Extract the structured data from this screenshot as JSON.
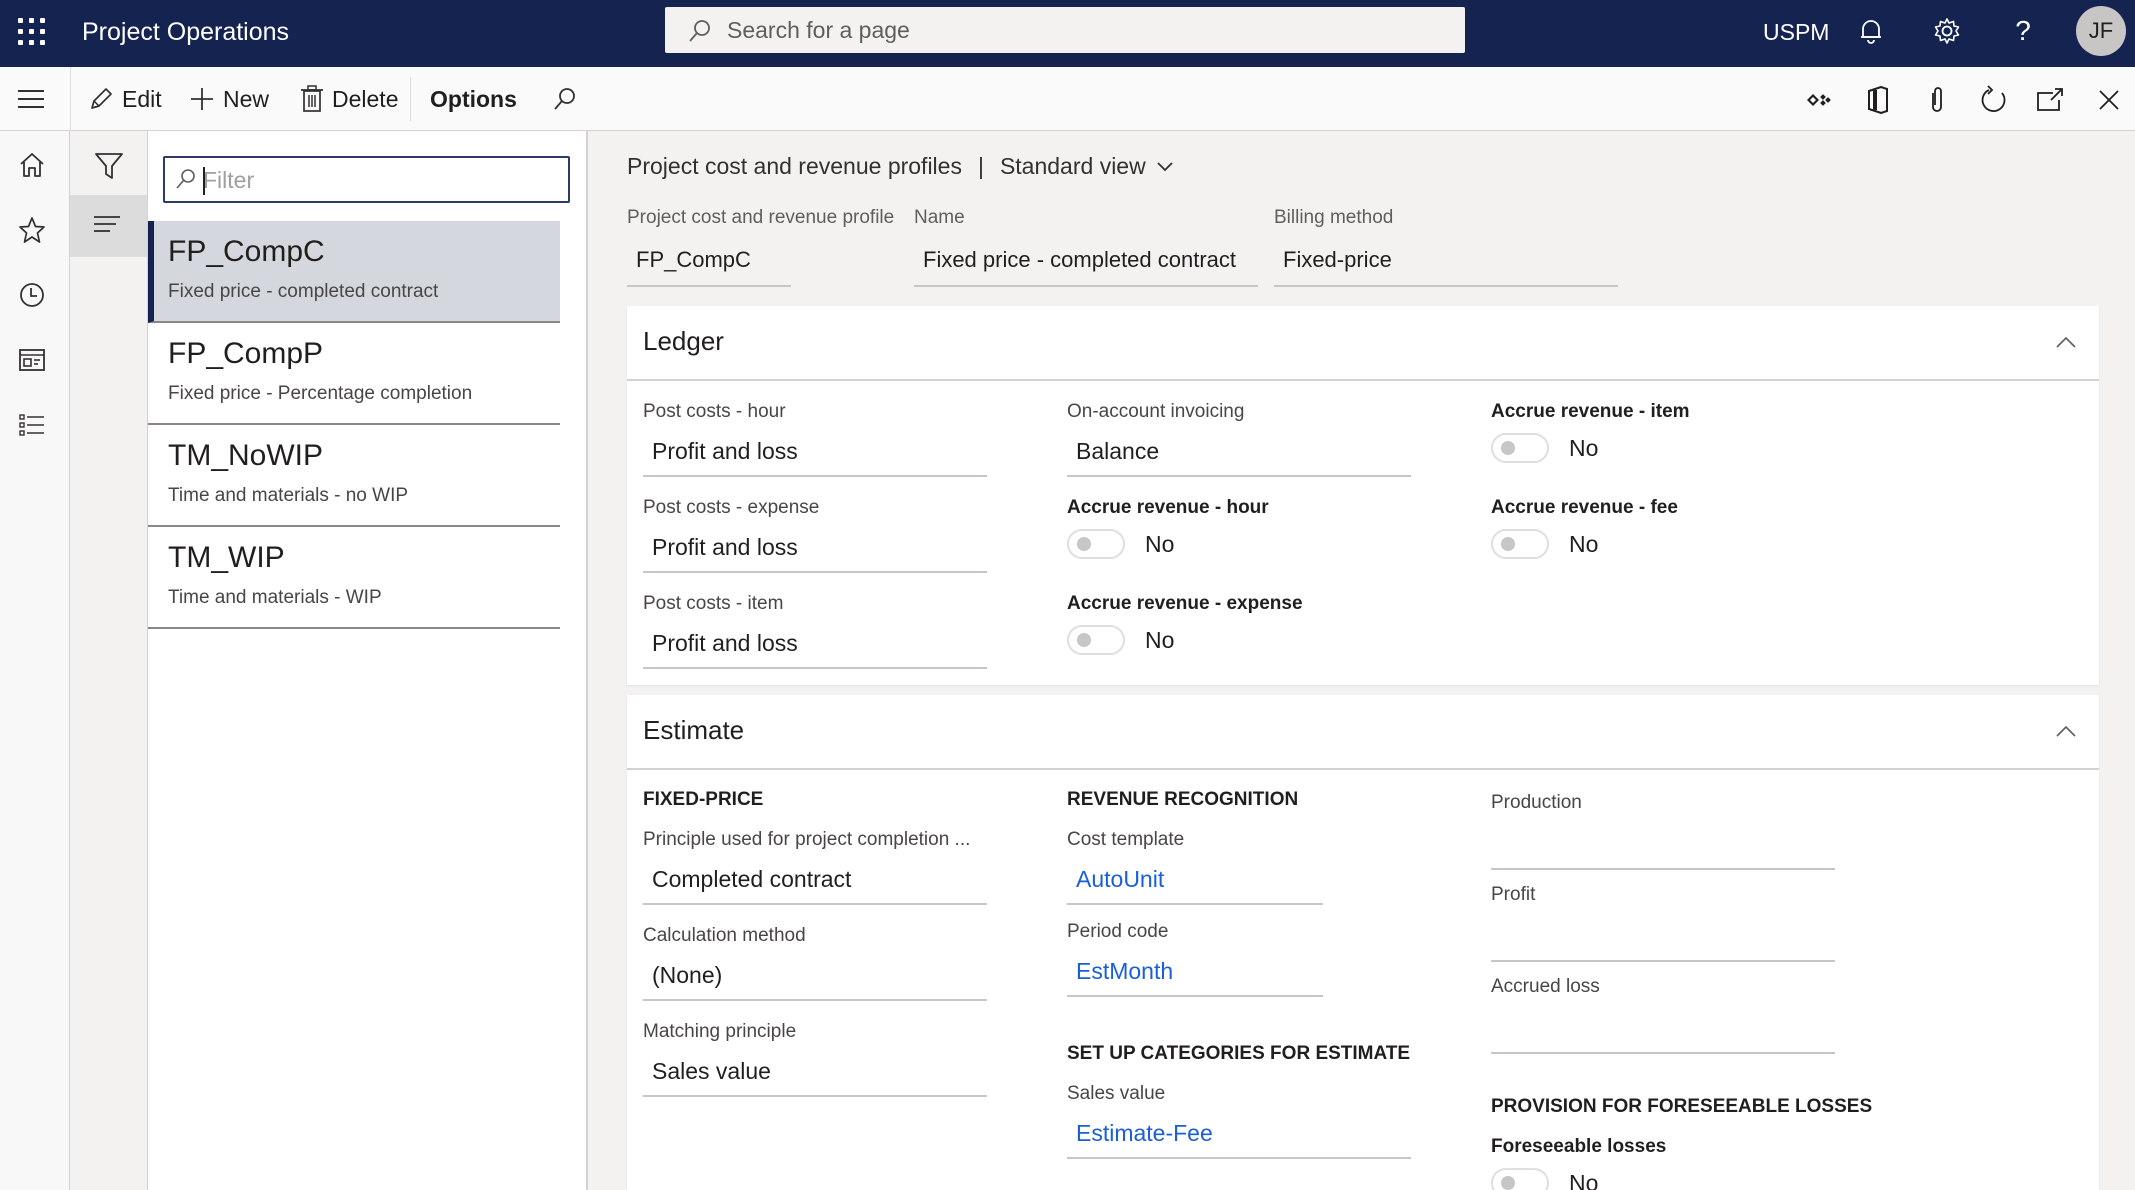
{
  "topbar": {
    "app_title": "Project Operations",
    "search_placeholder": "Search for a page",
    "company": "USPM",
    "avatar_initials": "JF",
    "icons": [
      "waffle-icon",
      "search-icon",
      "bell-icon",
      "gear-icon",
      "help-icon"
    ]
  },
  "actionbar": {
    "edit_label": "Edit",
    "new_label": "New",
    "delete_label": "Delete",
    "options_label": "Options",
    "attachments_count": "0",
    "right_icons": [
      "power-apps-icon",
      "office-icon",
      "attachment-icon",
      "refresh-icon",
      "open-new-window-icon",
      "close-icon"
    ]
  },
  "leftnav": {
    "items": [
      {
        "name": "home",
        "icon": "home-icon"
      },
      {
        "name": "favorites",
        "icon": "star-icon"
      },
      {
        "name": "recent",
        "icon": "clock-icon"
      },
      {
        "name": "workspaces",
        "icon": "workspace-icon"
      },
      {
        "name": "modules",
        "icon": "list-icon"
      }
    ]
  },
  "list": {
    "filter_placeholder": "Filter",
    "items": [
      {
        "id": "FP_CompC",
        "description": "Fixed price - completed contract",
        "selected": true
      },
      {
        "id": "FP_CompP",
        "description": "Fixed price - Percentage completion",
        "selected": false
      },
      {
        "id": "TM_NoWIP",
        "description": "Time and materials - no WIP",
        "selected": false
      },
      {
        "id": "TM_WIP",
        "description": "Time and materials - WIP",
        "selected": false
      }
    ]
  },
  "header": {
    "page_title": "Project cost and revenue profiles",
    "separator": "|",
    "view": "Standard view",
    "fields": [
      {
        "label": "Project cost and revenue profile",
        "value": "FP_CompC"
      },
      {
        "label": "Name",
        "value": "Fixed price - completed contract"
      },
      {
        "label": "Billing method",
        "value": "Fixed-price"
      }
    ]
  },
  "ledger": {
    "title": "Ledger",
    "post_costs_hour": {
      "label": "Post costs - hour",
      "value": "Profit and loss"
    },
    "post_costs_expense": {
      "label": "Post costs - expense",
      "value": "Profit and loss"
    },
    "post_costs_item": {
      "label": "Post costs - item",
      "value": "Profit and loss"
    },
    "on_account_invoicing": {
      "label": "On-account invoicing",
      "value": "Balance"
    },
    "accrue_revenue_hour": {
      "label": "Accrue revenue - hour",
      "value": "No",
      "on": false
    },
    "accrue_revenue_expense": {
      "label": "Accrue revenue - expense",
      "value": "No",
      "on": false
    },
    "accrue_revenue_item": {
      "label": "Accrue revenue - item",
      "value": "No",
      "on": false
    },
    "accrue_revenue_fee": {
      "label": "Accrue revenue - fee",
      "value": "No",
      "on": false
    }
  },
  "estimate": {
    "title": "Estimate",
    "fixed_price_group": "FIXED-PRICE",
    "principle": {
      "label": "Principle used for project completion ...",
      "value": "Completed contract"
    },
    "calc_method": {
      "label": "Calculation method",
      "value": "(None)"
    },
    "matching_principle": {
      "label": "Matching principle",
      "value": "Sales value"
    },
    "revenue_recognition_group": "REVENUE RECOGNITION",
    "cost_template": {
      "label": "Cost template",
      "value": "AutoUnit"
    },
    "period_code": {
      "label": "Period code",
      "value": "EstMonth"
    },
    "categories_group": "SET UP CATEGORIES FOR ESTIMATE",
    "sales_value": {
      "label": "Sales value",
      "value": "Estimate-Fee"
    },
    "production": {
      "label": "Production",
      "value": ""
    },
    "profit": {
      "label": "Profit",
      "value": ""
    },
    "accrued_loss": {
      "label": "Accrued loss",
      "value": ""
    },
    "provision_group": "PROVISION FOR FORESEEABLE LOSSES",
    "foreseeable_losses": {
      "label": "Foreseeable losses",
      "value": "No",
      "on": false
    }
  },
  "colors": {
    "nav_bar": "#152350",
    "link": "#1a5fd6",
    "selected_row": "#d5d7df"
  }
}
